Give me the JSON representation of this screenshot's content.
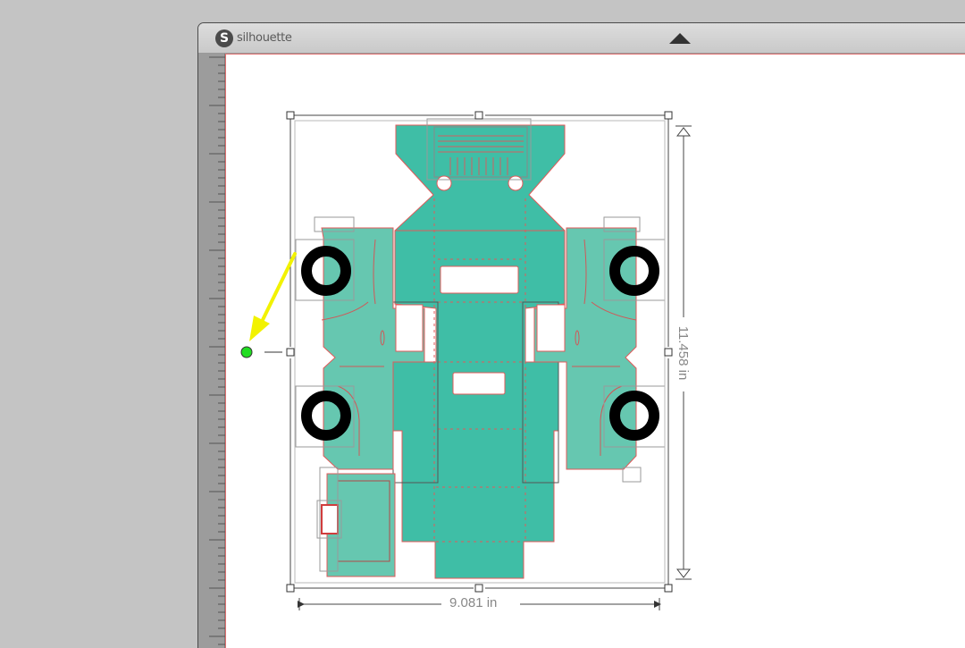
{
  "app": {
    "logo_glyph": "S",
    "logo_text": "silhouette"
  },
  "icons": {
    "logo": "silhouette-logo-icon",
    "collapse": "triangle-up-icon"
  },
  "selection": {
    "width_label": "9.081 in",
    "height_label": "11.458 in"
  },
  "colors": {
    "part_fill": "#3fbea6",
    "part_light": "#66c7b0",
    "cut_line": "#e05a5a",
    "tire": "#000000",
    "rotate_handle": "#22dd22",
    "annotation_arrow": "#f2f200",
    "handle_stroke": "#444444"
  }
}
